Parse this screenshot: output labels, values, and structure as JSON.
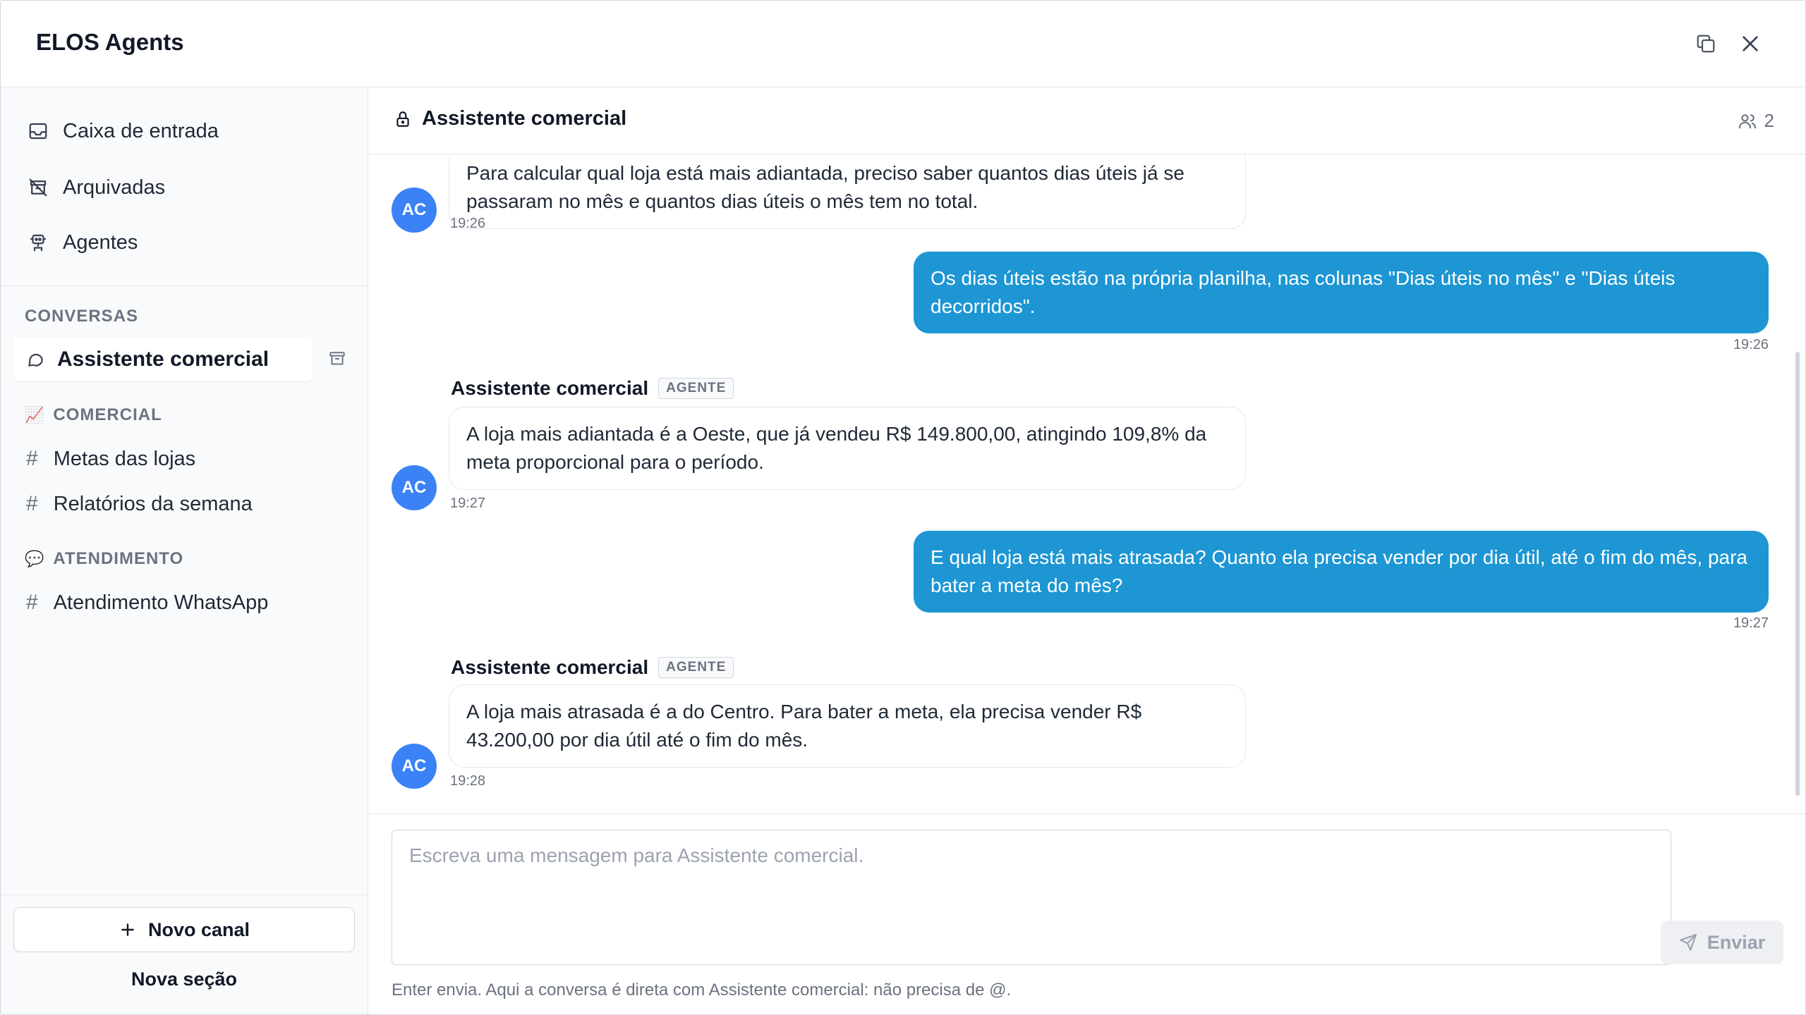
{
  "window": {
    "title": "ELOS Agents"
  },
  "sidebar": {
    "nav": [
      {
        "label": "Caixa de entrada",
        "icon": "inbox-icon"
      },
      {
        "label": "Arquivadas",
        "icon": "archive-off-icon"
      },
      {
        "label": "Agentes",
        "icon": "robot-icon"
      }
    ],
    "conversations_label": "CONVERSAS",
    "active_conversation": "Assistente comercial",
    "sections": [
      {
        "label": "COMERCIAL",
        "emoji": "📈",
        "channels": [
          "Metas das lojas",
          "Relatórios da semana"
        ]
      },
      {
        "label": "ATENDIMENTO",
        "emoji": "💬",
        "channels": [
          "Atendimento WhatsApp"
        ]
      }
    ],
    "new_channel": "Novo canal",
    "new_section": "Nova seção"
  },
  "chat": {
    "title": "Assistente comercial",
    "members_count": "2",
    "messages": [
      {
        "role": "agent",
        "avatar": "AC",
        "text": "Para calcular qual loja está mais adiantada, preciso saber quantos dias úteis já se passaram no mês e quantos dias úteis o mês tem no total.",
        "time": "19:26"
      },
      {
        "role": "user",
        "text": "Os dias úteis estão na própria planilha, nas colunas \"Dias úteis no mês\" e \"Dias úteis decorridos\".",
        "time": "19:26"
      },
      {
        "role": "agent",
        "sender": "Assistente comercial",
        "badge": "AGENTE",
        "avatar": "AC",
        "text": "A loja mais adiantada é a Oeste, que já vendeu R$ 149.800,00, atingindo 109,8% da meta proporcional para o período.",
        "time": "19:27"
      },
      {
        "role": "user",
        "text": "E qual loja está mais atrasada? Quanto ela precisa vender por dia útil, até o fim do mês, para bater a meta do mês?",
        "time": "19:27"
      },
      {
        "role": "agent",
        "sender": "Assistente comercial",
        "badge": "AGENTE",
        "avatar": "AC",
        "text": "A loja mais atrasada é a do Centro. Para bater a meta, ela precisa vender R$ 43.200,00 por dia útil até o fim do mês.",
        "time": "19:28"
      }
    ]
  },
  "composer": {
    "placeholder": "Escreva uma mensagem para Assistente comercial.",
    "send_label": "Enviar",
    "hint": "Enter envia. Aqui a conversa é direta com Assistente comercial: não precisa de @."
  },
  "colors": {
    "accent": "#1d96d3",
    "avatar": "#3b82f6"
  }
}
